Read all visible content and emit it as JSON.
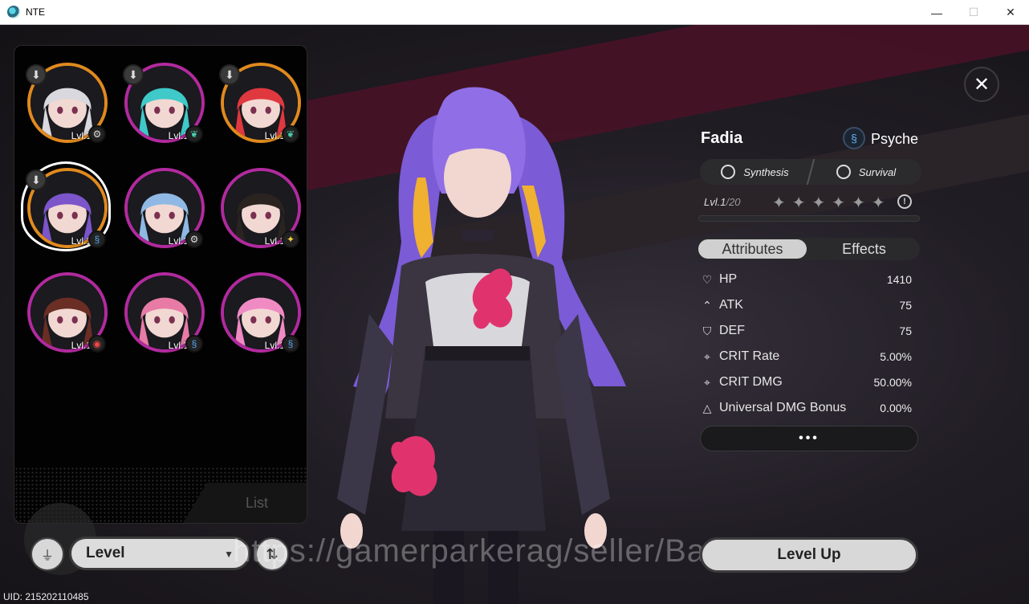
{
  "window": {
    "title": "NTE",
    "minimize": "—",
    "maximize": "☐",
    "close": "✕"
  },
  "close_overlay": "✕",
  "roster": {
    "list_tab": "List",
    "characters": [
      {
        "level": "Lvl.1",
        "element_icon": "gear-icon",
        "downloadable": true,
        "ring": "orange",
        "hair": "#d8d8de"
      },
      {
        "level": "Lvl.1",
        "element_icon": "leaf-icon",
        "downloadable": true,
        "ring": "pink",
        "hair": "#3fc9c9"
      },
      {
        "level": "Lvl.1",
        "element_icon": "leaf-icon",
        "downloadable": true,
        "ring": "orange",
        "hair": "#e0383f"
      },
      {
        "level": "Lvl.1",
        "element_icon": "psyche-icon",
        "downloadable": true,
        "ring": "orange",
        "hair": "#7b55c9",
        "selected": true
      },
      {
        "level": "Lvl.1",
        "element_icon": "gear-icon",
        "downloadable": false,
        "ring": "pink",
        "hair": "#8fb9e4"
      },
      {
        "level": "Lvl.1",
        "element_icon": "spark-icon",
        "downloadable": false,
        "ring": "pink",
        "hair": "#2a2320"
      },
      {
        "level": "Lvl.1",
        "element_icon": "fire-icon",
        "downloadable": false,
        "ring": "pink",
        "hair": "#6a2e25"
      },
      {
        "level": "Lvl.1",
        "element_icon": "psyche-icon",
        "downloadable": false,
        "ring": "pink",
        "hair": "#e77ba6"
      },
      {
        "level": "Lvl.1",
        "element_icon": "psyche-icon",
        "downloadable": false,
        "ring": "pink",
        "hair": "#f08ac3"
      }
    ]
  },
  "controls": {
    "sort_label": "Level",
    "filter_icon": "filter-icon",
    "order_icon": "sort-order-icon"
  },
  "uid": "UID: 215202110485",
  "character": {
    "name": "Fadia",
    "element": "Psyche",
    "tags": [
      "Synthesis",
      "Survival"
    ],
    "level_label": "Lvl.",
    "level": "1",
    "level_max": "/20",
    "stars_total": 6,
    "tabs": {
      "attributes": "Attributes",
      "effects": "Effects"
    },
    "stats": [
      {
        "name": "HP",
        "value": "1410",
        "icon": "heart-icon"
      },
      {
        "name": "ATK",
        "value": "75",
        "icon": "atk-icon"
      },
      {
        "name": "DEF",
        "value": "75",
        "icon": "shield-icon"
      },
      {
        "name": "CRIT Rate",
        "value": "5.00%",
        "icon": "crosshair-icon"
      },
      {
        "name": "CRIT DMG",
        "value": "50.00%",
        "icon": "crosshair-icon"
      },
      {
        "name": "Universal DMG Bonus",
        "value": "0.00%",
        "icon": "triangle-icon"
      }
    ],
    "more_label": "•••",
    "level_up_label": "Level Up"
  },
  "watermark": "https://gamerparkerag/seller/BangJohn",
  "colors": {
    "accent_pink": "#b22a9e",
    "accent_orange": "#e08a1e",
    "banner": "#4a1226"
  }
}
